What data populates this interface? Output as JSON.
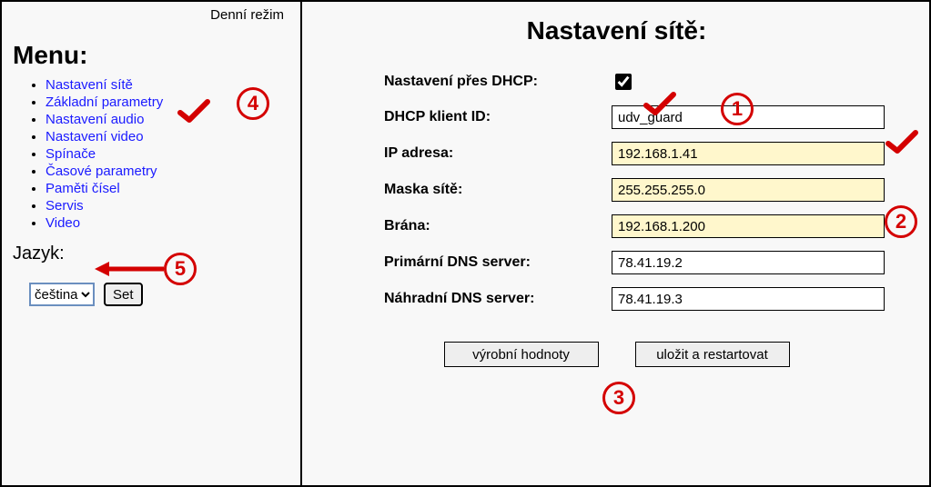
{
  "mode_label": "Denní režim",
  "menu_title": "Menu:",
  "menu_items": [
    "Nastavení sítě",
    "Základní parametry",
    "Nastavení audio",
    "Nastavení video",
    "Spínače",
    "Časové parametry",
    "Paměti čísel",
    "Servis",
    "Video"
  ],
  "lang_title": "Jazyk:",
  "lang_selected": "čeština",
  "lang_set_button": "Set",
  "main_title": "Nastavení sítě:",
  "form": {
    "dhcp_label": "Nastavení přes DHCP:",
    "dhcp_checked": true,
    "dhcp_client_id_label": "DHCP klient ID:",
    "dhcp_client_id_value": "udv_guard",
    "ip_label": "IP adresa:",
    "ip_value": "192.168.1.41",
    "mask_label": "Maska sítě:",
    "mask_value": "255.255.255.0",
    "gateway_label": "Brána:",
    "gateway_value": "192.168.1.200",
    "dns1_label": "Primární DNS server:",
    "dns1_value": "78.41.19.2",
    "dns2_label": "Náhradní DNS server:",
    "dns2_value": "78.41.19.3"
  },
  "buttons": {
    "defaults": "výrobní hodnoty",
    "save_restart": "uložit a restartovat"
  },
  "annotations": {
    "n1": "1",
    "n2": "2",
    "n3": "3",
    "n4": "4",
    "n5": "5"
  }
}
